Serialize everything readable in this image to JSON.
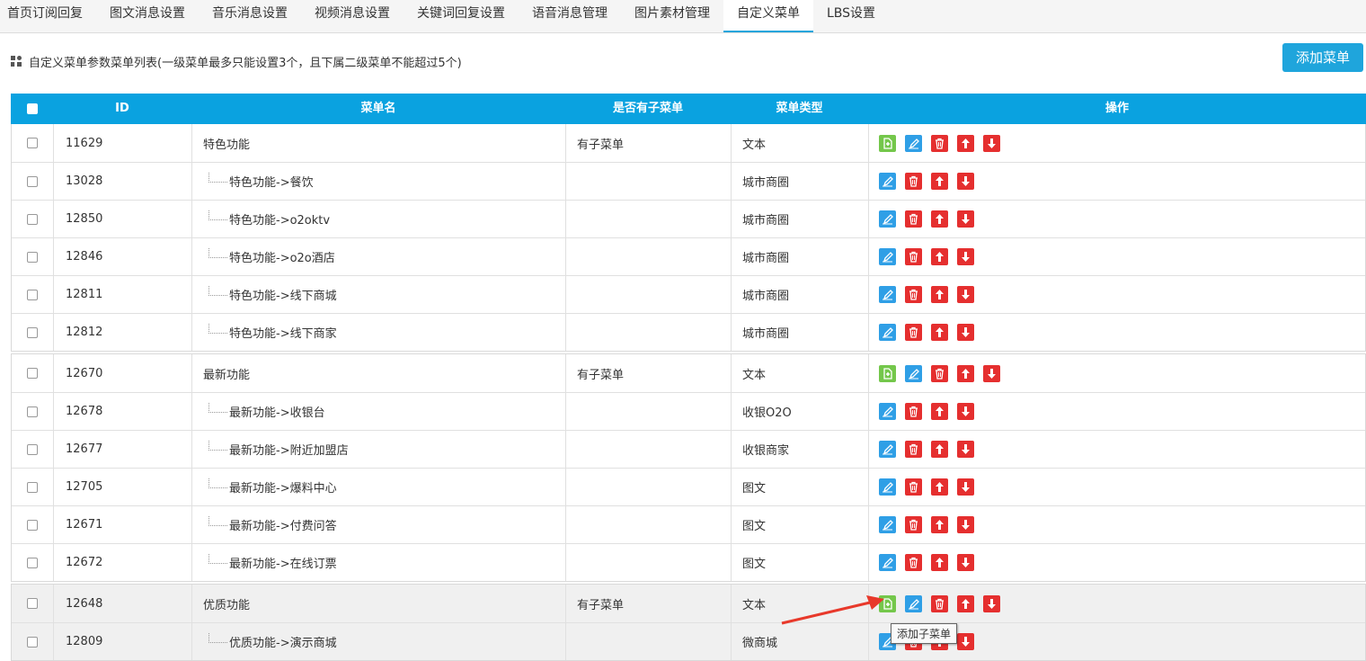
{
  "tabs": [
    "首页订阅回复",
    "图文消息设置",
    "音乐消息设置",
    "视频消息设置",
    "关键词回复设置",
    "语音消息管理",
    "图片素材管理",
    "自定义菜单",
    "LBS设置"
  ],
  "active_tab": 7,
  "toolbar": {
    "description": "自定义菜单参数菜单列表(一级菜单最多只能设置3个，且下属二级菜单不能超过5个)",
    "add_menu": "添加菜单"
  },
  "table": {
    "headers": {
      "id": "ID",
      "name": "菜单名",
      "has_sub": "是否有子菜单",
      "type": "菜单类型",
      "ops": "操作"
    },
    "groups": [
      {
        "highlight": false,
        "rows": [
          {
            "id": "11629",
            "name": "特色功能",
            "child": false,
            "has_sub": "有子菜单",
            "type": "文本"
          },
          {
            "id": "13028",
            "name": "特色功能->餐饮",
            "child": true,
            "has_sub": "",
            "type": "城市商圈"
          },
          {
            "id": "12850",
            "name": "特色功能->o2oktv",
            "child": true,
            "has_sub": "",
            "type": "城市商圈"
          },
          {
            "id": "12846",
            "name": "特色功能->o2o酒店",
            "child": true,
            "has_sub": "",
            "type": "城市商圈"
          },
          {
            "id": "12811",
            "name": "特色功能->线下商城",
            "child": true,
            "has_sub": "",
            "type": "城市商圈"
          },
          {
            "id": "12812",
            "name": "特色功能->线下商家",
            "child": true,
            "has_sub": "",
            "type": "城市商圈"
          }
        ]
      },
      {
        "highlight": false,
        "rows": [
          {
            "id": "12670",
            "name": "最新功能",
            "child": false,
            "has_sub": "有子菜单",
            "type": "文本"
          },
          {
            "id": "12678",
            "name": "最新功能->收银台",
            "child": true,
            "has_sub": "",
            "type": "收银O2O"
          },
          {
            "id": "12677",
            "name": "最新功能->附近加盟店",
            "child": true,
            "has_sub": "",
            "type": "收银商家"
          },
          {
            "id": "12705",
            "name": "最新功能->爆料中心",
            "child": true,
            "has_sub": "",
            "type": "图文"
          },
          {
            "id": "12671",
            "name": "最新功能->付费问答",
            "child": true,
            "has_sub": "",
            "type": "图文"
          },
          {
            "id": "12672",
            "name": "最新功能->在线订票",
            "child": true,
            "has_sub": "",
            "type": "图文"
          }
        ]
      },
      {
        "highlight": true,
        "rows": [
          {
            "id": "12648",
            "name": "优质功能",
            "child": false,
            "has_sub": "有子菜单",
            "type": "文本"
          },
          {
            "id": "12809",
            "name": "优质功能->演示商城",
            "child": true,
            "has_sub": "",
            "type": "微商城"
          }
        ]
      }
    ]
  },
  "tooltip": "添加子菜单",
  "icons": {
    "add_sub": "add-submenu-icon",
    "edit": "edit-icon",
    "delete": "delete-icon",
    "up": "move-up-icon",
    "down": "move-down-icon"
  },
  "colors": {
    "header": "#0aa2e0",
    "add_button": "#1fa5dc",
    "add_icon": "#74c74b",
    "edit_icon": "#2f9fe6",
    "danger_icon": "#e52f2f",
    "highlight_row": "#f0f0f0",
    "annotation_arrow": "#e8392b"
  }
}
